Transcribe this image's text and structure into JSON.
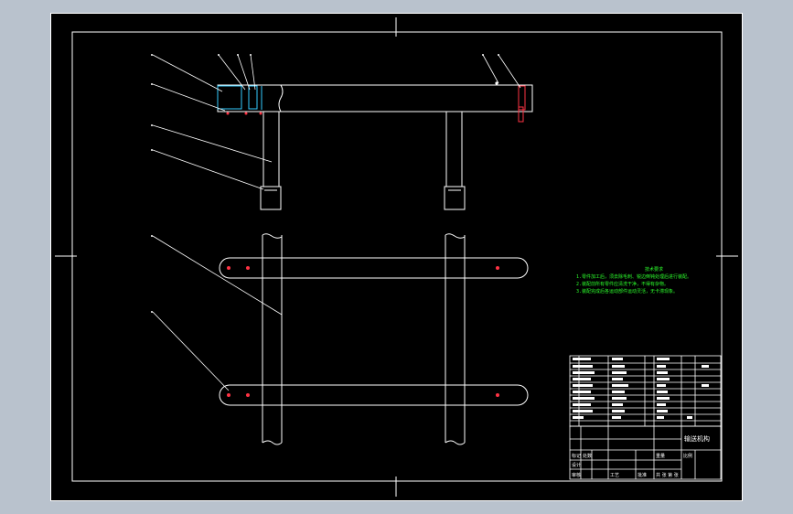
{
  "drawing": {
    "notes_title": "技术要求",
    "notes": [
      "1.零件加工后，须去除毛刺、锐边倒钝处理后进行装配。",
      "2.装配前所有零件应清洗干净，不得有杂物。",
      "3.装配完成后各运动部件运动灵活，无卡滞现象。"
    ],
    "title_block": {
      "drawing_name": "输送机构",
      "marks": [
        "标记",
        "处数",
        "设计",
        "审核",
        "工艺",
        "批准"
      ],
      "scale_label": "比例",
      "weight_label": "重量",
      "sheet_label": "共 张 第 张"
    }
  },
  "colors": {
    "sheet": "#000000",
    "line": "#ffffff",
    "accent_cyan": "#33ccff",
    "accent_red": "#ff3344",
    "notes_green": "#2cff2c"
  }
}
